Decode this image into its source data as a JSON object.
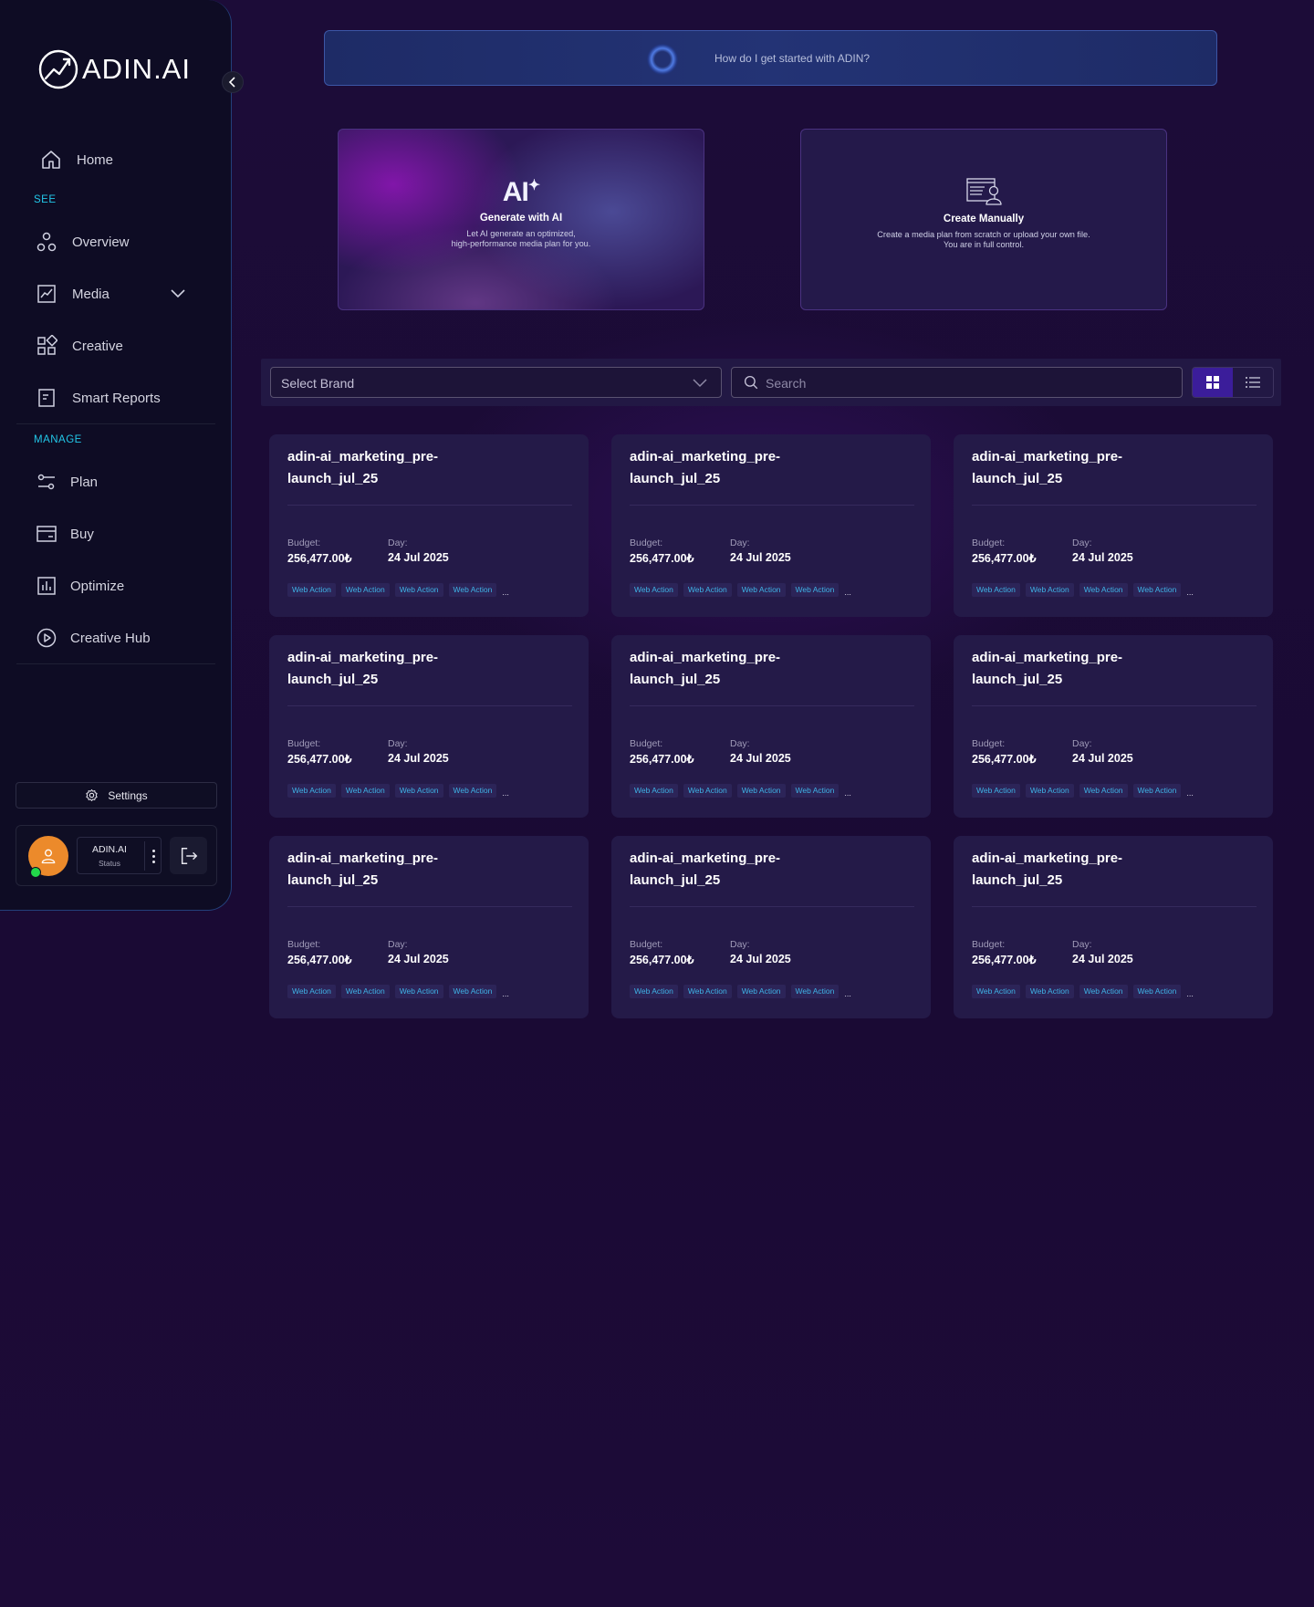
{
  "sidebar": {
    "logo_text": "ADIN.AI",
    "home_label": "Home",
    "see_label": "SEE",
    "overview_label": "Overview",
    "media_label": "Media",
    "creative_label": "Creative",
    "smart_reports_label": "Smart Reports",
    "manage_label": "MANAGE",
    "plan_label": "Plan",
    "buy_label": "Buy",
    "optimize_label": "Optimize",
    "creative_hub_label": "Creative Hub",
    "settings_label": "Settings",
    "user_name": "ADIN.AI",
    "user_status": "Status"
  },
  "prompt": {
    "text": "How do I get started with ADIN?"
  },
  "create": {
    "ai_logo": "AI",
    "ai_title": "Generate with AI",
    "ai_desc_line1": "Let AI generate an optimized,",
    "ai_desc_line2": "high-performance media plan for you.",
    "manual_title": "Create Manually",
    "manual_desc_line1": "Create a media plan from scratch or upload your own file.",
    "manual_desc_line2": "You are in full control."
  },
  "filters": {
    "brand_placeholder": "Select Brand",
    "search_placeholder": "Search"
  },
  "colors": {
    "background": "#1b0b36",
    "accent_cyan": "#22c7e8",
    "tag_text": "#3fb3e6",
    "avatar": "#ec8a2b",
    "online": "#22d84a"
  },
  "plans": [
    {
      "title": "adin-ai_marketing_pre-launch_jul_25",
      "budget_label": "Budget:",
      "budget": "256,477.00₺",
      "day_label": "Day:",
      "day": "24 Jul 2025",
      "tags": [
        "Web Action",
        "Web Action",
        "Web Action",
        "Web Action"
      ],
      "more": "..."
    },
    {
      "title": "adin-ai_marketing_pre-launch_jul_25",
      "budget_label": "Budget:",
      "budget": "256,477.00₺",
      "day_label": "Day:",
      "day": "24 Jul 2025",
      "tags": [
        "Web Action",
        "Web Action",
        "Web Action",
        "Web Action"
      ],
      "more": "..."
    },
    {
      "title": "adin-ai_marketing_pre-launch_jul_25",
      "budget_label": "Budget:",
      "budget": "256,477.00₺",
      "day_label": "Day:",
      "day": "24 Jul 2025",
      "tags": [
        "Web Action",
        "Web Action",
        "Web Action",
        "Web Action"
      ],
      "more": "..."
    },
    {
      "title": "adin-ai_marketing_pre-launch_jul_25",
      "budget_label": "Budget:",
      "budget": "256,477.00₺",
      "day_label": "Day:",
      "day": "24 Jul 2025",
      "tags": [
        "Web Action",
        "Web Action",
        "Web Action",
        "Web Action"
      ],
      "more": "..."
    },
    {
      "title": "adin-ai_marketing_pre-launch_jul_25",
      "budget_label": "Budget:",
      "budget": "256,477.00₺",
      "day_label": "Day:",
      "day": "24 Jul 2025",
      "tags": [
        "Web Action",
        "Web Action",
        "Web Action",
        "Web Action"
      ],
      "more": "..."
    },
    {
      "title": "adin-ai_marketing_pre-launch_jul_25",
      "budget_label": "Budget:",
      "budget": "256,477.00₺",
      "day_label": "Day:",
      "day": "24 Jul 2025",
      "tags": [
        "Web Action",
        "Web Action",
        "Web Action",
        "Web Action"
      ],
      "more": "..."
    },
    {
      "title": "adin-ai_marketing_pre-launch_jul_25",
      "budget_label": "Budget:",
      "budget": "256,477.00₺",
      "day_label": "Day:",
      "day": "24 Jul 2025",
      "tags": [
        "Web Action",
        "Web Action",
        "Web Action",
        "Web Action"
      ],
      "more": "..."
    },
    {
      "title": "adin-ai_marketing_pre-launch_jul_25",
      "budget_label": "Budget:",
      "budget": "256,477.00₺",
      "day_label": "Day:",
      "day": "24 Jul 2025",
      "tags": [
        "Web Action",
        "Web Action",
        "Web Action",
        "Web Action"
      ],
      "more": "..."
    },
    {
      "title": "adin-ai_marketing_pre-launch_jul_25",
      "budget_label": "Budget:",
      "budget": "256,477.00₺",
      "day_label": "Day:",
      "day": "24 Jul 2025",
      "tags": [
        "Web Action",
        "Web Action",
        "Web Action",
        "Web Action"
      ],
      "more": "..."
    }
  ]
}
